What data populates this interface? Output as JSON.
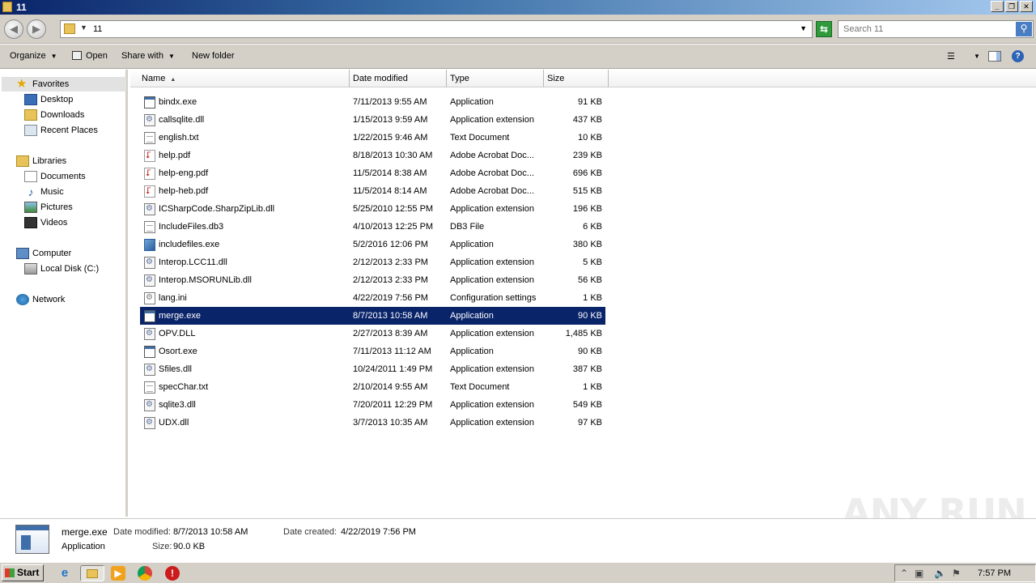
{
  "window": {
    "title": "11"
  },
  "address": {
    "path": "11",
    "search_placeholder": "Search 11"
  },
  "toolbar": {
    "organize": "Organize",
    "open": "Open",
    "share_with": "Share with",
    "new_folder": "New folder"
  },
  "nav": {
    "favorites": "Favorites",
    "desktop": "Desktop",
    "downloads": "Downloads",
    "recent_places": "Recent Places",
    "libraries": "Libraries",
    "documents": "Documents",
    "music": "Music",
    "pictures": "Pictures",
    "videos": "Videos",
    "computer": "Computer",
    "local_disk": "Local Disk (C:)",
    "network": "Network"
  },
  "columns": {
    "name": "Name",
    "date": "Date modified",
    "type": "Type",
    "size": "Size"
  },
  "files": [
    {
      "name": "bindx.exe",
      "date": "7/11/2013 9:55 AM",
      "type": "Application",
      "size": "91 KB",
      "icon": "exe"
    },
    {
      "name": "callsqlite.dll",
      "date": "1/15/2013 9:59 AM",
      "type": "Application extension",
      "size": "437 KB",
      "icon": "dll"
    },
    {
      "name": "english.txt",
      "date": "1/22/2015 9:46 AM",
      "type": "Text Document",
      "size": "10 KB",
      "icon": "txt"
    },
    {
      "name": "help.pdf",
      "date": "8/18/2013 10:30 AM",
      "type": "Adobe Acrobat Doc...",
      "size": "239 KB",
      "icon": "pdf"
    },
    {
      "name": "help-eng.pdf",
      "date": "11/5/2014 8:38 AM",
      "type": "Adobe Acrobat Doc...",
      "size": "696 KB",
      "icon": "pdf"
    },
    {
      "name": "help-heb.pdf",
      "date": "11/5/2014 8:14 AM",
      "type": "Adobe Acrobat Doc...",
      "size": "515 KB",
      "icon": "pdf"
    },
    {
      "name": "ICSharpCode.SharpZipLib.dll",
      "date": "5/25/2010 12:55 PM",
      "type": "Application extension",
      "size": "196 KB",
      "icon": "dll"
    },
    {
      "name": "IncludeFiles.db3",
      "date": "4/10/2013 12:25 PM",
      "type": "DB3 File",
      "size": "6 KB",
      "icon": "txt"
    },
    {
      "name": "includefiles.exe",
      "date": "5/2/2016 12:06 PM",
      "type": "Application",
      "size": "380 KB",
      "icon": "inst"
    },
    {
      "name": "Interop.LCC11.dll",
      "date": "2/12/2013 2:33 PM",
      "type": "Application extension",
      "size": "5 KB",
      "icon": "dll"
    },
    {
      "name": "Interop.MSORUNLib.dll",
      "date": "2/12/2013 2:33 PM",
      "type": "Application extension",
      "size": "56 KB",
      "icon": "dll"
    },
    {
      "name": "lang.ini",
      "date": "4/22/2019 7:56 PM",
      "type": "Configuration settings",
      "size": "1 KB",
      "icon": "ini"
    },
    {
      "name": "merge.exe",
      "date": "8/7/2013 10:58 AM",
      "type": "Application",
      "size": "90 KB",
      "icon": "exe"
    },
    {
      "name": "OPV.DLL",
      "date": "2/27/2013 8:39 AM",
      "type": "Application extension",
      "size": "1,485 KB",
      "icon": "dll"
    },
    {
      "name": "Osort.exe",
      "date": "7/11/2013 11:12 AM",
      "type": "Application",
      "size": "90 KB",
      "icon": "exe"
    },
    {
      "name": "Sfiles.dll",
      "date": "10/24/2011 1:49 PM",
      "type": "Application extension",
      "size": "387 KB",
      "icon": "dll"
    },
    {
      "name": "specChar.txt",
      "date": "2/10/2014 9:55 AM",
      "type": "Text Document",
      "size": "1 KB",
      "icon": "txt"
    },
    {
      "name": "sqlite3.dll",
      "date": "7/20/2011 12:29 PM",
      "type": "Application extension",
      "size": "549 KB",
      "icon": "dll"
    },
    {
      "name": "UDX.dll",
      "date": "3/7/2013 10:35 AM",
      "type": "Application extension",
      "size": "97 KB",
      "icon": "dll"
    }
  ],
  "selected_file": "merge.exe",
  "details": {
    "name": "merge.exe",
    "modified_label": "Date modified:",
    "modified": "8/7/2013 10:58 AM",
    "created_label": "Date created:",
    "created": "4/22/2019 7:56 PM",
    "type": "Application",
    "size_label": "Size:",
    "size": "90.0 KB"
  },
  "watermark": "ANY RUN",
  "taskbar": {
    "start": "Start",
    "clock": "7:57 PM"
  },
  "colors": {
    "selection": "#0a246a",
    "chrome": "#d4d0c8"
  }
}
